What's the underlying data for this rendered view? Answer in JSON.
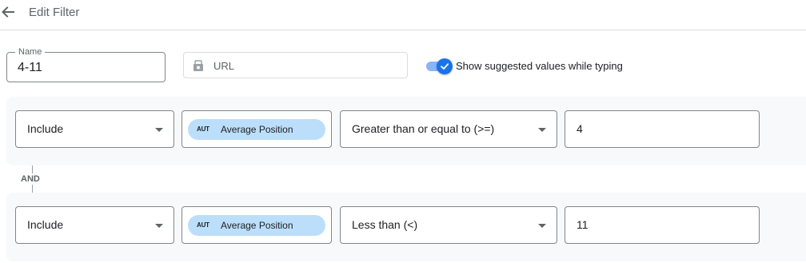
{
  "header": {
    "title": "Edit Filter",
    "back_icon": "arrow-left-icon"
  },
  "name_field": {
    "label": "Name",
    "value": "4-11"
  },
  "dimension": {
    "label": "URL",
    "icon": "dimension-icon"
  },
  "toggle": {
    "checked": true,
    "label": "Show suggested values while typing",
    "accent": "#1a73e8"
  },
  "conditions": [
    {
      "include": "Include",
      "field_badge": "AUT",
      "field": "Average Position",
      "operator": "Greater than or equal to (>=)",
      "value": "4"
    },
    {
      "include": "Include",
      "field_badge": "AUT",
      "field": "Average Position",
      "operator": "Less than (<)",
      "value": "11"
    }
  ],
  "connector": "AND",
  "colors": {
    "chip": "#bbdefb",
    "row_bg": "#f8f9fa",
    "border": "#80868b"
  }
}
